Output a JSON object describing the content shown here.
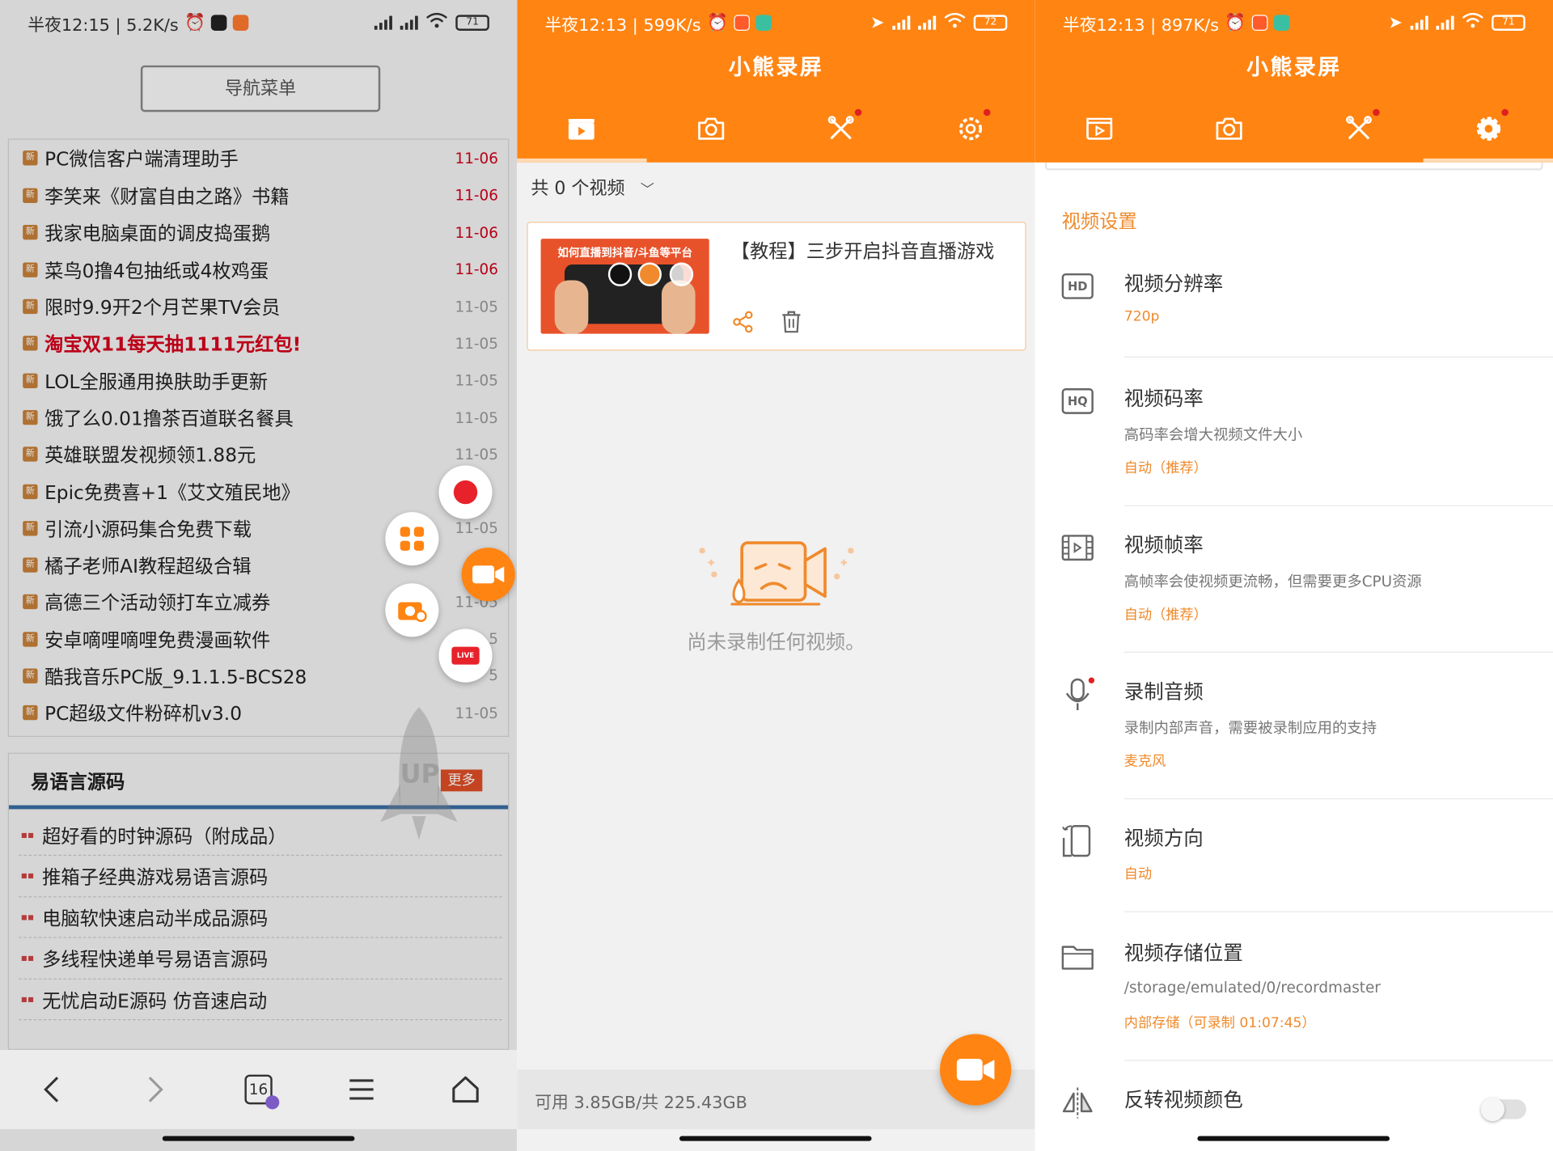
{
  "panel_browser": {
    "status": {
      "time": "半夜12:15 | 5.2K/s",
      "battery": "71"
    },
    "nav_menu_label": "导航菜单",
    "news": [
      {
        "title": "PC微信客户端清理助手",
        "date": "11-06",
        "date_color": "red"
      },
      {
        "title": "李笑来《财富自由之路》书籍",
        "date": "11-06",
        "date_color": "red"
      },
      {
        "title": "我家电脑桌面的调皮捣蛋鹅",
        "date": "11-06",
        "date_color": "red"
      },
      {
        "title": "菜鸟0撸4包抽纸或4枚鸡蛋",
        "date": "11-06",
        "date_color": "red"
      },
      {
        "title": "限时9.9开2个月芒果TV会员",
        "date": "11-05",
        "date_color": "gray"
      },
      {
        "title": "淘宝双11每天抽1111元红包!",
        "date": "11-05",
        "date_color": "gray",
        "hot": true
      },
      {
        "title": "LOL全服通用换肤助手更新",
        "date": "11-05",
        "date_color": "gray"
      },
      {
        "title": "饿了么0.01撸茶百道联名餐具",
        "date": "11-05",
        "date_color": "gray"
      },
      {
        "title": "英雄联盟发视频领1.88元",
        "date": "11-05",
        "date_color": "gray"
      },
      {
        "title": "Epic免费喜+1《艾文殖民地》",
        "date": "",
        "date_color": "gray"
      },
      {
        "title": "引流小源码集合免费下载",
        "date": "11-05",
        "date_color": "gray"
      },
      {
        "title": "橘子老师AI教程超级合辑",
        "date": "11",
        "date_color": "gray"
      },
      {
        "title": "高德三个活动领打车立减券",
        "date": "11-05",
        "date_color": "gray"
      },
      {
        "title": "安卓嘀哩嘀哩免费漫画软件",
        "date": "5",
        "date_color": "gray"
      },
      {
        "title": "酷我音乐PC版_9.1.1.5-BCS28",
        "date": "5",
        "date_color": "gray"
      },
      {
        "title": "PC超级文件粉碎机v3.0",
        "date": "11-05",
        "date_color": "gray"
      }
    ],
    "news_icon_char": "新",
    "source_section": {
      "title": "易语言源码",
      "more": "更多",
      "watermark": "UP",
      "items": [
        "超好看的时钟源码（附成品）",
        "推箱子经典游戏易语言源码",
        "电脑软快速启动半成品源码",
        "多线程快递单号易语言源码",
        "无忧启动E源码 仿音速启动"
      ]
    },
    "tab_count": "16",
    "float_live_label": "LIVE"
  },
  "panel_videos": {
    "status": {
      "time": "半夜12:13 | 599K/s",
      "battery": "72"
    },
    "app_title": "小熊录屏",
    "video_count": "共 0 个视频",
    "card": {
      "title": "【教程】三步开启抖音直播游戏",
      "thumb_caption": "如何直播到抖音/斗鱼等平台"
    },
    "empty_text": "尚未录制任何视频。",
    "storage": "可用 3.85GB/共 225.43GB"
  },
  "panel_settings": {
    "status": {
      "time": "半夜12:13 | 897K/s",
      "battery": "71"
    },
    "app_title": "小熊录屏",
    "section_title": "视频设置",
    "items": [
      {
        "icon": "hd-icon",
        "icon_text": "HD",
        "name": "视频分辨率",
        "desc": "",
        "value": "720p"
      },
      {
        "icon": "hq-icon",
        "icon_text": "HQ",
        "name": "视频码率",
        "desc": "高码率会增大视频文件大小",
        "value": "自动（推荐）"
      },
      {
        "icon": "film-icon",
        "icon_text": "",
        "name": "视频帧率",
        "desc": "高帧率会使视频更流畅，但需要更多CPU资源",
        "value": "自动（推荐）"
      },
      {
        "icon": "microphone-icon",
        "icon_text": "",
        "name": "录制音频",
        "desc": "录制内部声音，需要被录制应用的支持",
        "value": "麦克风"
      },
      {
        "icon": "rotate-phone-icon",
        "icon_text": "",
        "name": "视频方向",
        "desc": "",
        "value": "自动"
      },
      {
        "icon": "folder-icon",
        "icon_text": "",
        "name": "视频存储位置",
        "desc": "/storage/emulated/0/recordmaster",
        "value": "内部存储（可录制 01:07:45）"
      },
      {
        "icon": "invert-color-icon",
        "icon_text": "",
        "name": "反转视频颜色",
        "desc": "",
        "value": ""
      }
    ],
    "invert_toggle_on": false
  },
  "colors": {
    "accent": "#ff8412",
    "setting_value": "#f08a2c",
    "hot_red": "#d6001c"
  }
}
